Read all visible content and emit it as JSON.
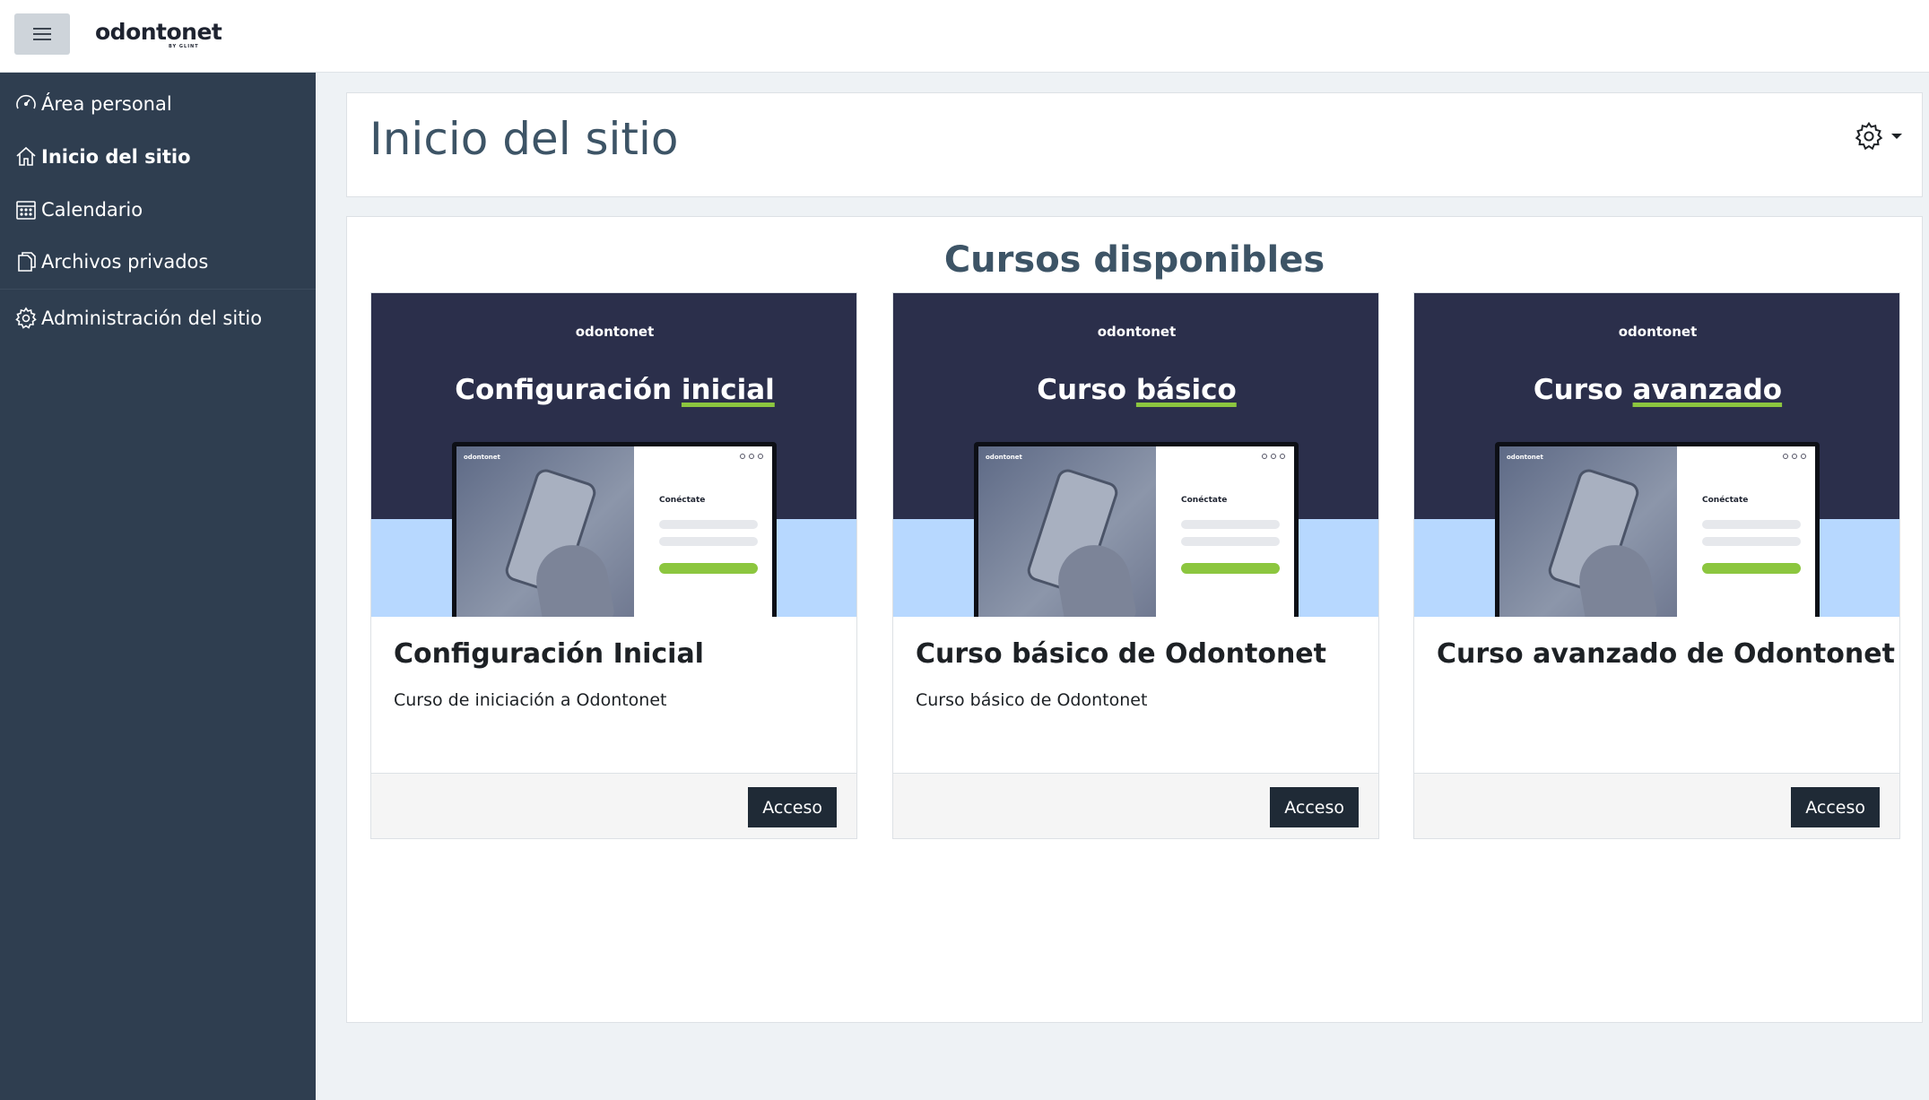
{
  "navbar": {
    "logo_text": "odontonet",
    "logo_subtext": "BY GLINT"
  },
  "sidebar": {
    "items": [
      {
        "label": "Área personal",
        "icon": "dashboard-icon"
      },
      {
        "label": "Inicio del sitio",
        "icon": "home-icon",
        "active": true
      },
      {
        "label": "Calendario",
        "icon": "calendar-icon"
      },
      {
        "label": "Archivos privados",
        "icon": "files-icon"
      },
      {
        "label": "Administración del sitio",
        "icon": "gear-icon"
      }
    ]
  },
  "header": {
    "title": "Inicio del sitio"
  },
  "main": {
    "section_title": "Cursos disponibles",
    "courses": [
      {
        "image_brand": "odontonet",
        "image_title_plain": "Configuración",
        "image_title_highlight": "inicial",
        "screen_brand": "odontonet",
        "screen_login": "Conéctate",
        "name": "Configuración Inicial",
        "summary": "Curso de iniciación a Odontonet",
        "button": "Acceso"
      },
      {
        "image_brand": "odontonet",
        "image_title_plain": "Curso",
        "image_title_highlight": "básico",
        "screen_brand": "odontonet",
        "screen_login": "Conéctate",
        "name": "Curso básico de Odontonet",
        "summary": "Curso básico de Odontonet",
        "button": "Acceso"
      },
      {
        "image_brand": "odontonet",
        "image_title_plain": "Curso",
        "image_title_highlight": "avanzado",
        "screen_brand": "odontonet",
        "screen_login": "Conéctate",
        "name": "Curso avanzado de Odontonet",
        "summary": "",
        "button": "Acceso"
      }
    ]
  },
  "colors": {
    "sidebar_bg": "#2f3e50",
    "image_dark": "#2b2f4b",
    "image_light": "#b7d8ff",
    "accent_green": "#8cc63f",
    "button_dark": "#1f2a36"
  }
}
